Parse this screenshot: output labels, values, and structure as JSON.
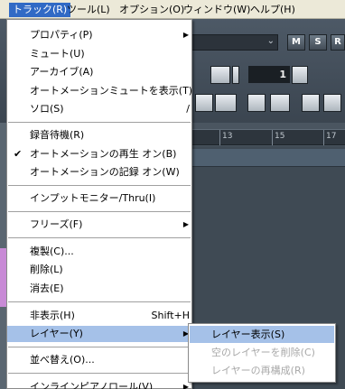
{
  "menubar": {
    "items": [
      {
        "label": "トラック(R)",
        "active": true
      },
      {
        "label": "ツール(L)",
        "active": false
      },
      {
        "label": "オプション(O)",
        "active": false
      },
      {
        "label": "ウィンドウ(W)",
        "active": false
      },
      {
        "label": "ヘルプ(H)",
        "active": false
      }
    ]
  },
  "toolbar": {
    "buttons_top": [
      "M",
      "S",
      "R"
    ],
    "value": "1"
  },
  "ruler": {
    "ticks": [
      "13",
      "15",
      "17"
    ]
  },
  "track_menu": {
    "items": [
      {
        "label": "プロパティ(P)",
        "submenu": true
      },
      {
        "label": "ミュート(U)"
      },
      {
        "label": "アーカイブ(A)"
      },
      {
        "label": "オートメーションミュートを表示(T)"
      },
      {
        "label": "ソロ(S)",
        "shortcut": "/"
      },
      {
        "label": "録音待機(R)"
      },
      {
        "label": "オートメーションの再生 オン(B)",
        "checked": true
      },
      {
        "label": "オートメーションの記録 オン(W)"
      },
      {
        "label": "インプットモニター/Thru(I)"
      },
      {
        "label": "フリーズ(F)",
        "submenu": true
      },
      {
        "label": "複製(C)..."
      },
      {
        "label": "削除(L)"
      },
      {
        "label": "消去(E)"
      },
      {
        "label": "非表示(H)",
        "shortcut": "Shift+H"
      },
      {
        "label": "レイヤー(Y)",
        "submenu": true,
        "highlighted": true
      },
      {
        "label": "並べ替え(O)..."
      },
      {
        "label": "インラインピアノロール(V)",
        "submenu": true
      }
    ],
    "check_glyph": "✔",
    "submenu_glyph": "▶"
  },
  "layer_submenu": {
    "items": [
      {
        "label": "レイヤー表示(S)",
        "highlighted": true,
        "disabled": false
      },
      {
        "label": "空のレイヤーを削除(C)",
        "highlighted": false,
        "disabled": true
      },
      {
        "label": "レイヤーの再構成(R)",
        "highlighted": false,
        "disabled": true
      }
    ]
  },
  "colors": {
    "highlight": "#a5c1e8",
    "menubar_active": "#316ac5",
    "disabled_text": "#a8a8a8"
  }
}
